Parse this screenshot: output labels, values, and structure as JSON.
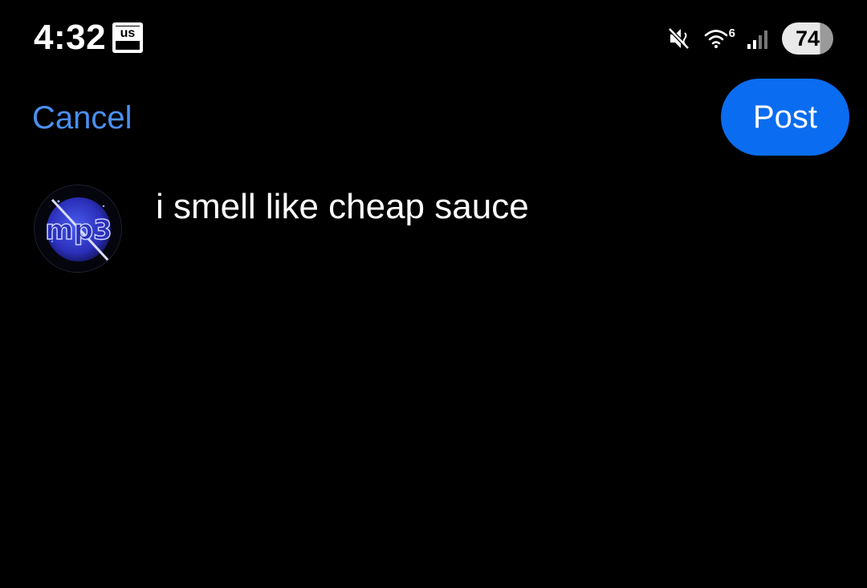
{
  "status_bar": {
    "time": "4:32",
    "app_badge": "us",
    "icons": [
      "mute-icon",
      "wifi-icon",
      "signal-icon"
    ],
    "wifi_label": "6",
    "battery_level": "74"
  },
  "header": {
    "cancel_label": "Cancel",
    "post_label": "Post"
  },
  "compose": {
    "avatar_text": "mp3",
    "text": "i smell like cheap sauce"
  },
  "colors": {
    "background": "#000000",
    "cancel": "#4a90f0",
    "post_button": "#0a6cf0",
    "text": "#ffffff"
  }
}
